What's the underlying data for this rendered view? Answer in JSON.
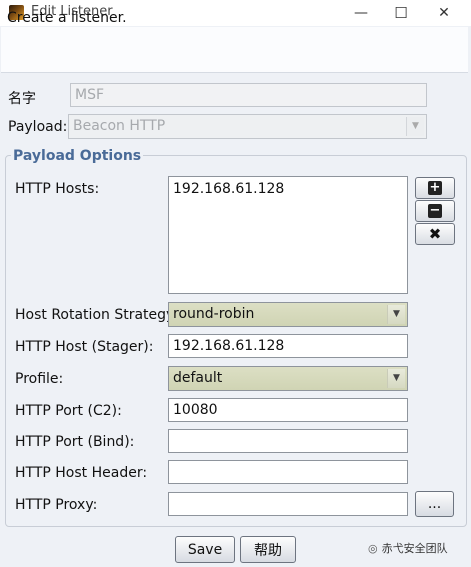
{
  "window": {
    "title": "Edit Listener",
    "minimize_glyph": "—",
    "maximize_glyph": "☐",
    "close_glyph": "✕"
  },
  "description": "Create a listener.",
  "form": {
    "name_label": "名字",
    "name_value": "MSF",
    "payload_label": "Payload:",
    "payload_value": "Beacon HTTP"
  },
  "payload_options": {
    "title": "Payload Options",
    "http_hosts_label": "HTTP Hosts:",
    "http_hosts": [
      "192.168.61.128"
    ],
    "host_rotation_label": "Host Rotation Strategy:",
    "host_rotation_value": "round-robin",
    "http_host_stager_label": "HTTP Host (Stager):",
    "http_host_stager_value": "192.168.61.128",
    "profile_label": "Profile:",
    "profile_value": "default",
    "http_port_c2_label": "HTTP Port (C2):",
    "http_port_c2_value": "10080",
    "http_port_bind_label": "HTTP Port (Bind):",
    "http_port_bind_value": "",
    "http_host_header_label": "HTTP Host Header:",
    "http_host_header_value": "",
    "http_proxy_label": "HTTP Proxy:",
    "http_proxy_value": "",
    "proxy_browse_label": "...",
    "add_glyph": "+",
    "remove_glyph": "−",
    "clear_glyph": "✖"
  },
  "buttons": {
    "save_label": "Save",
    "help_label": "帮助"
  },
  "watermark": {
    "text": "赤弋安全团队"
  },
  "colors": {
    "group_title": "#4a6b98",
    "combo_fill": "#d4d8b9",
    "window_bg": "#eef1f6"
  }
}
